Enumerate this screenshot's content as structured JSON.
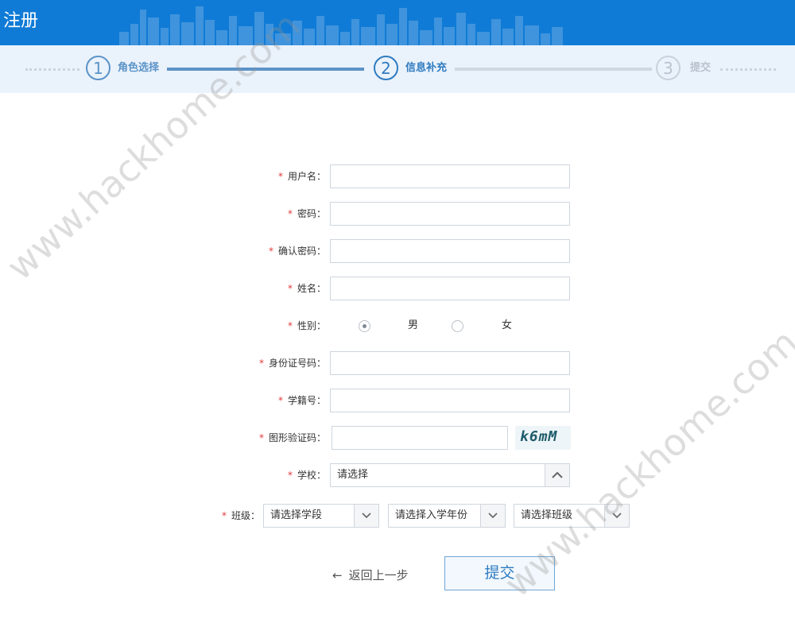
{
  "header": {
    "title": "注册"
  },
  "steps": [
    {
      "num": "1",
      "label": "角色选择",
      "state": "done"
    },
    {
      "num": "2",
      "label": "信息补充",
      "state": "current"
    },
    {
      "num": "3",
      "label": "提交",
      "state": "todo"
    }
  ],
  "form": {
    "required_mark": "*",
    "username_label": "用户名：",
    "password_label": "密码：",
    "confirm_password_label": "确认密码：",
    "name_label": "姓名：",
    "gender_label": "性别：",
    "gender_options": [
      "男",
      "女"
    ],
    "gender_selected": "男",
    "id_number_label": "身份证号码：",
    "student_no_label": "学籍号：",
    "captcha_label": "图形验证码：",
    "captcha_text": "k6mM",
    "school_label": "学校：",
    "school_value": "请选择",
    "class_label": "班级：",
    "class_selects": [
      "请选择学段",
      "请选择入学年份",
      "请选择班级"
    ]
  },
  "actions": {
    "back_label": "返回上一步",
    "submit_label": "提交"
  },
  "watermark": "www.hackhome.com",
  "colors": {
    "header": "#0f7bd6",
    "step_active": "#2f7bc0",
    "step_done_bar": "#5b93c7",
    "step_todo": "#c7d2dd",
    "required": "#e4393c"
  }
}
